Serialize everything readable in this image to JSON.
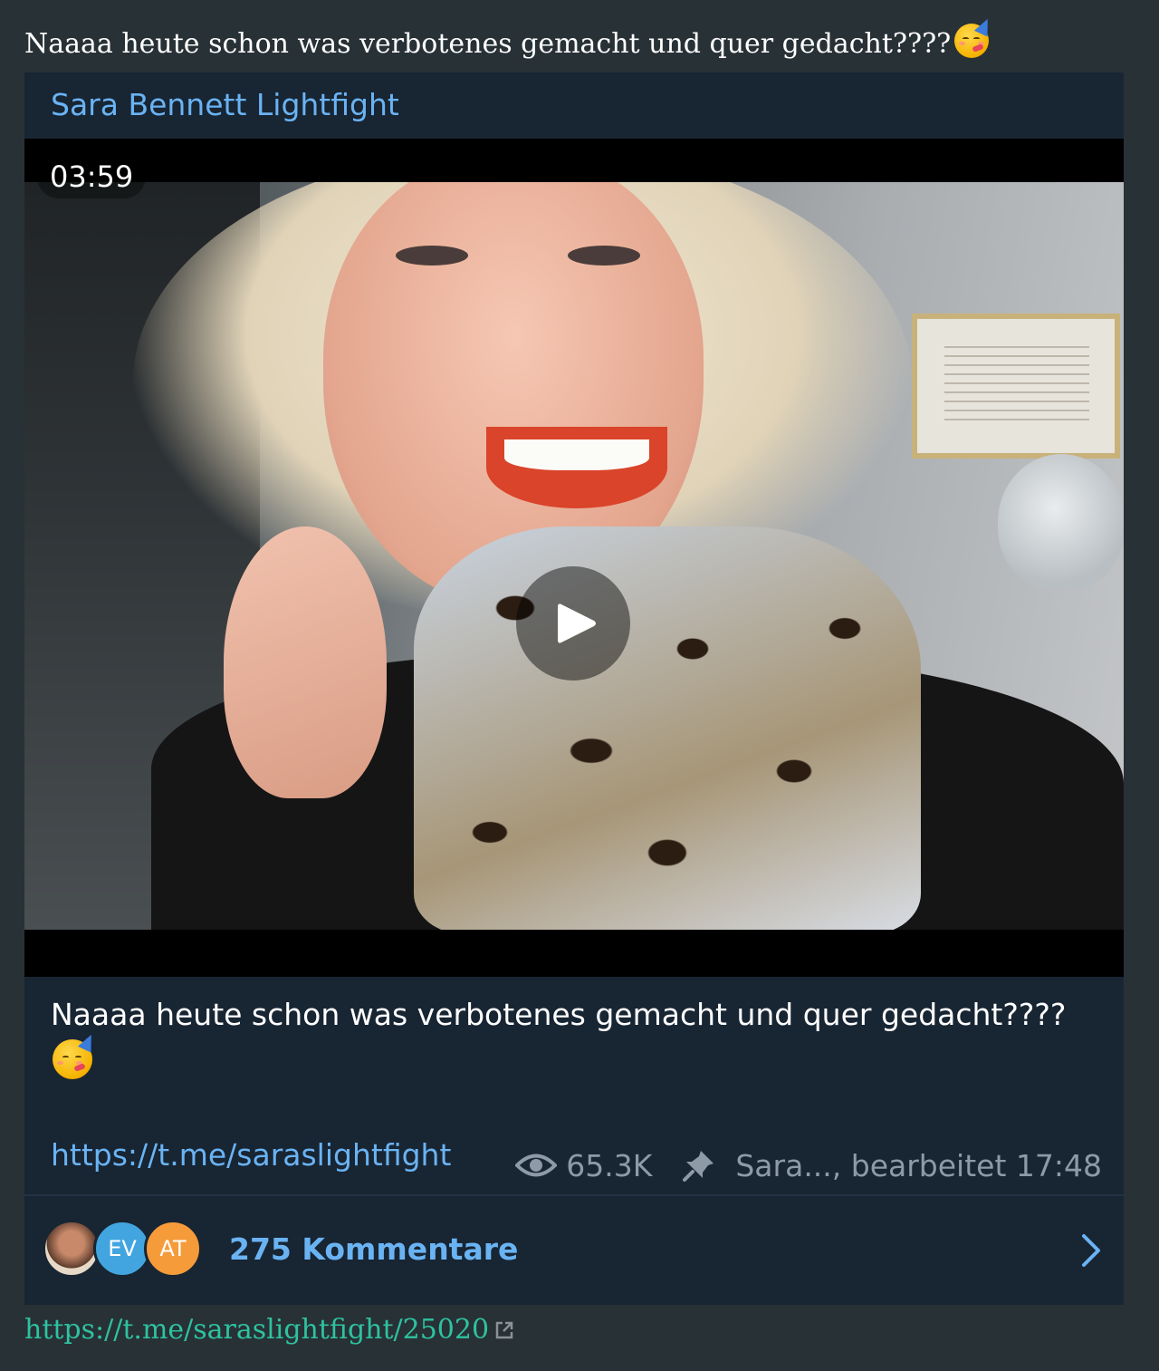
{
  "post": {
    "title": "Naaaa heute schon was verbotenes gemacht und quer gedacht????",
    "title_emoji": "partying-face-emoji"
  },
  "card": {
    "channel_name": "Sara Bennett Lightfight",
    "video": {
      "duration": "03:59",
      "play_icon": "play-icon"
    },
    "caption": "Naaaa heute schon was verbotenes gemacht und quer gedacht????",
    "caption_emoji": "partying-face-emoji",
    "link": "https://t.me/saraslightfight",
    "views": "65.3K",
    "author_edited": "Sara..., bearbeitet 17:48",
    "comments": {
      "avatars": [
        {
          "type": "photo",
          "initials": ""
        },
        {
          "type": "initials",
          "initials": "EV",
          "color": "#42a5e0"
        },
        {
          "type": "initials",
          "initials": "AT",
          "color": "#f59b3a"
        }
      ],
      "label": "275 Kommentare"
    }
  },
  "source_link": "https://t.me/saraslightfight/25020",
  "colors": {
    "page_bg": "#283136",
    "card_bg": "#182533",
    "accent_blue": "#6ab3f3",
    "meta_gray": "#8e9aa6",
    "link_green": "#2ec2a0"
  }
}
